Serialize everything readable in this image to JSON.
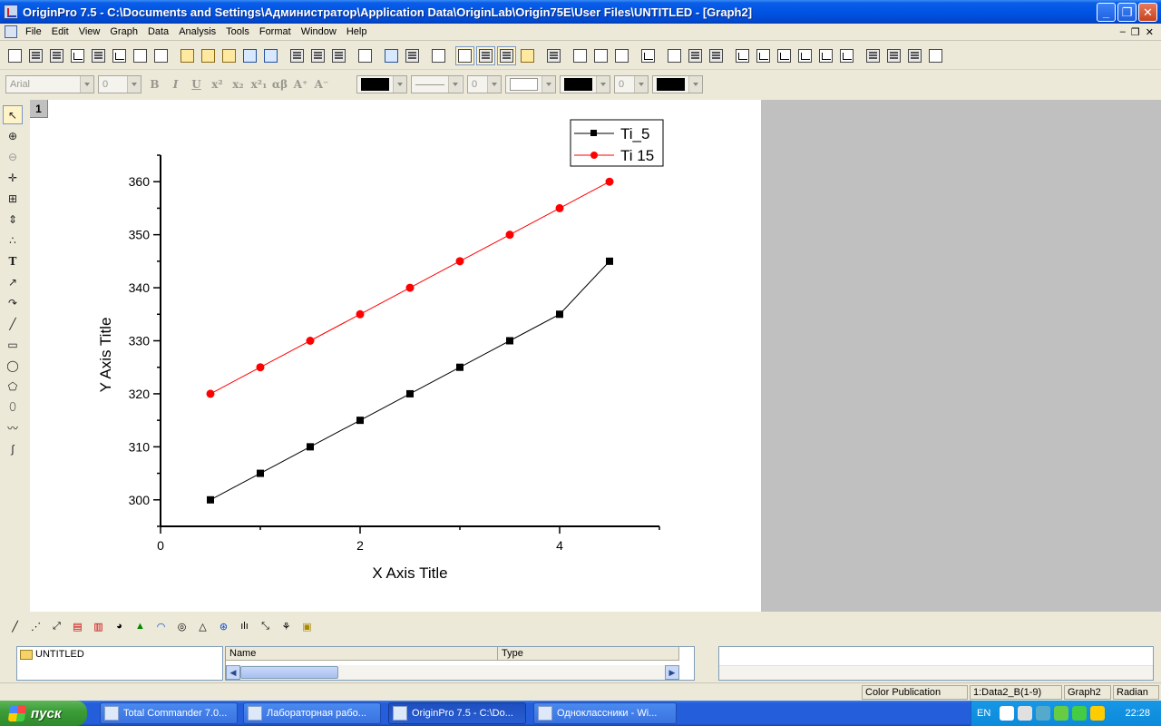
{
  "window": {
    "title": "OriginPro 7.5 - C:\\Documents and Settings\\Администратор\\Application Data\\OriginLab\\Origin75E\\User Files\\UNTITLED - [Graph2]",
    "controls": {
      "minimize": "_",
      "maximize": "❐",
      "close": "✕"
    }
  },
  "menu": [
    "File",
    "Edit",
    "View",
    "Graph",
    "Data",
    "Analysis",
    "Tools",
    "Format",
    "Window",
    "Help"
  ],
  "mdi_controls": {
    "minimize": "–",
    "restore": "❐",
    "close": "✕"
  },
  "format_toolbar": {
    "font": "Arial",
    "font_size": "0",
    "bold": "B",
    "italic": "I",
    "underline": "U",
    "superscript": "x²",
    "subscript": "x₂",
    "supsub": "x²₁",
    "greek": "αβ",
    "increase_font": "A⁺",
    "decrease_font": "A⁻",
    "line_width": "0",
    "border_width": "0"
  },
  "left_tools": [
    "pointer",
    "zoom-in",
    "zoom-out",
    "screen-reader",
    "data-selector",
    "data-reader",
    "draw-data",
    "text",
    "arrow",
    "curved-arrow",
    "line",
    "rectangle",
    "ellipse",
    "polygon",
    "region",
    "polyline",
    "freehand"
  ],
  "graph": {
    "layer_label": "1",
    "colors": {
      "series1": "#000000",
      "series2": "#ff0000",
      "page": "#ffffff",
      "mdi_bg": "#c0c0c0"
    }
  },
  "chart_data": {
    "type": "line",
    "xlabel": "X Axis Title",
    "ylabel": "Y Axis Title",
    "xlim": [
      0,
      5
    ],
    "ylim": [
      295,
      365
    ],
    "x_ticks": [
      "0",
      "2",
      "4"
    ],
    "y_ticks": [
      "300",
      "310",
      "320",
      "330",
      "340",
      "350",
      "360"
    ],
    "grid": false,
    "legend_position": "top-right",
    "series": [
      {
        "name": "Ti_5",
        "color": "#000000",
        "marker": "square",
        "x": [
          0.5,
          1.0,
          1.5,
          2.0,
          2.5,
          3.0,
          3.5,
          4.0,
          4.5
        ],
        "y": [
          300,
          305,
          310,
          315,
          320,
          325,
          330,
          335,
          345
        ]
      },
      {
        "name": "Ti 15",
        "color": "#ff0000",
        "marker": "circle",
        "x": [
          0.5,
          1.0,
          1.5,
          2.0,
          2.5,
          3.0,
          3.5,
          4.0,
          4.5
        ],
        "y": [
          320,
          325,
          330,
          335,
          340,
          345,
          350,
          355,
          360
        ]
      }
    ]
  },
  "explorer": {
    "folder": "UNTITLED",
    "columns": [
      "Name",
      "Type"
    ]
  },
  "status": {
    "mode": "Color Publication",
    "data": "1:Data2_B(1-9)",
    "window": "Graph2",
    "angle": "Radian"
  },
  "taskbar": {
    "start": "пуск",
    "tasks": [
      {
        "label": "Total Commander 7.0...",
        "active": false
      },
      {
        "label": "Лабораторная рабо...",
        "active": false
      },
      {
        "label": "OriginPro 7.5 - C:\\Do...",
        "active": true
      },
      {
        "label": "Одноклассники - Wi...",
        "active": false
      }
    ],
    "language": "EN",
    "clock": "22:28"
  }
}
